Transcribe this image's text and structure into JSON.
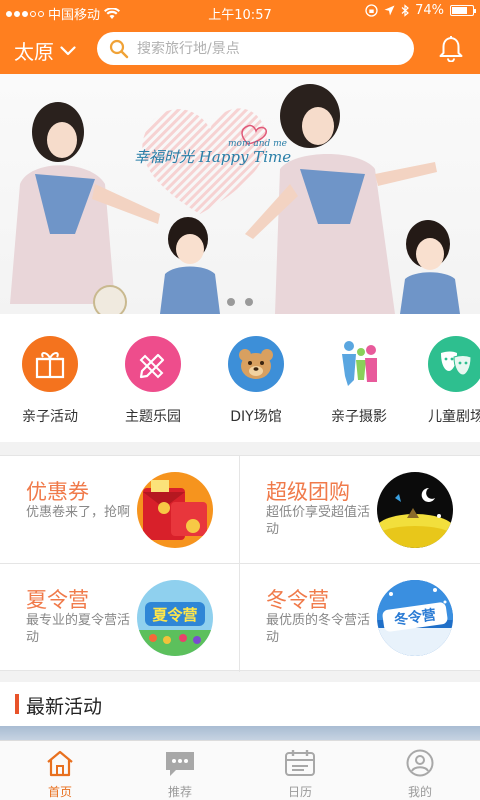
{
  "status": {
    "carrier": "中国移动",
    "time": "上午10:57",
    "battery": "74%",
    "battery_level": 0.74
  },
  "header": {
    "city": "太原",
    "search_placeholder": "搜索旅行地/景点"
  },
  "banner": {
    "slide_text": "幸福时光 Happy Time",
    "slide_subtext": "mom and me",
    "page_count": 2,
    "active_page": 1
  },
  "categories": [
    {
      "label": "亲子活动",
      "icon": "gift-box-icon",
      "color": "#f4731e"
    },
    {
      "label": "主题乐园",
      "icon": "pencil-ruler-icon",
      "color": "#ee4d8c"
    },
    {
      "label": "DIY场馆",
      "icon": "bear-face-icon",
      "color": "#3d8fd8"
    },
    {
      "label": "亲子摄影",
      "icon": "family-icon",
      "color": "#ffffff"
    },
    {
      "label": "儿童剧场",
      "icon": "theater-masks-icon",
      "color": "#2ebf8f"
    }
  ],
  "promos": [
    {
      "title": "优惠券",
      "subtitle": "优惠卷来了，抢啊",
      "image": "red-envelope-image"
    },
    {
      "title": "超级团购",
      "subtitle": "超低价享受超值活动",
      "image": "moonlight-scene-image"
    },
    {
      "title": "夏令营",
      "subtitle": "最专业的夏令营活动",
      "image": "summer-camp-image",
      "badge": "夏令营"
    },
    {
      "title": "冬令营",
      "subtitle": "最优质的冬令营活动",
      "image": "winter-camp-image",
      "badge": "冬令营"
    }
  ],
  "section": {
    "title": "最新活动"
  },
  "tabs": [
    {
      "label": "首页",
      "icon": "home-icon",
      "active": true
    },
    {
      "label": "推荐",
      "icon": "chat-bubble-icon",
      "active": false
    },
    {
      "label": "日历",
      "icon": "calendar-icon",
      "active": false
    },
    {
      "label": "我的",
      "icon": "user-icon",
      "active": false
    }
  ],
  "colors": {
    "accent": "#ff7f1f",
    "promo_title": "#f07a4a",
    "section_bar": "#e8532a"
  }
}
